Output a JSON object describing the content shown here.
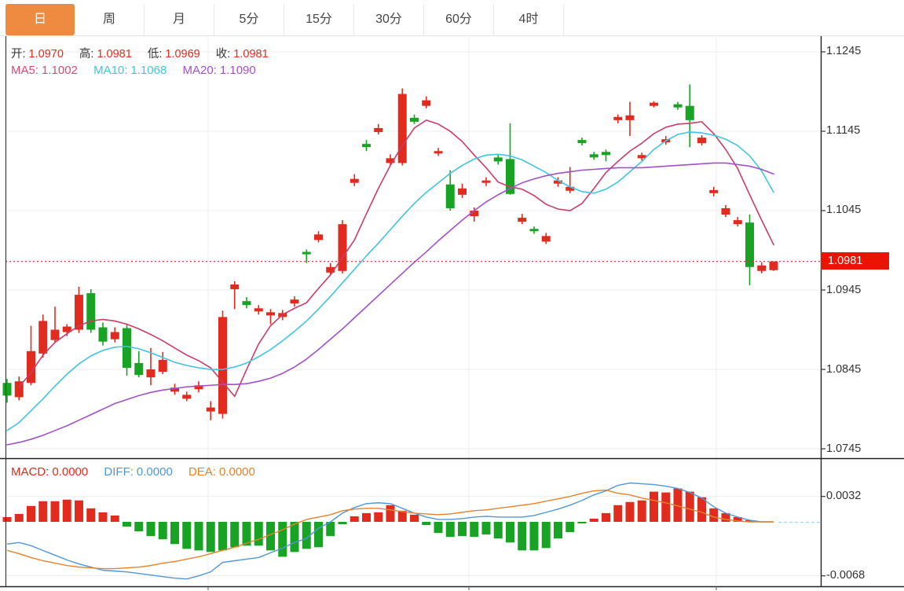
{
  "tabs": {
    "items": [
      {
        "label": "日",
        "active": true
      },
      {
        "label": "周",
        "active": false
      },
      {
        "label": "月",
        "active": false
      },
      {
        "label": "5分",
        "active": false
      },
      {
        "label": "15分",
        "active": false
      },
      {
        "label": "30分",
        "active": false
      },
      {
        "label": "60分",
        "active": false
      },
      {
        "label": "4时",
        "active": false
      }
    ]
  },
  "main_chart": {
    "info": {
      "open_label": "开:",
      "open_value": "1.0970",
      "high_label": "高:",
      "high_value": "1.0981",
      "low_label": "低:",
      "low_value": "1.0969",
      "close_label": "收:",
      "close_value": "1.0981"
    },
    "ma_info": {
      "ma5_label": "MA5:",
      "ma5_value": "1.1002",
      "ma10_label": "MA10:",
      "ma10_value": "1.1068",
      "ma20_label": "MA20:",
      "ma20_value": "1.1090"
    },
    "y_axis": [
      "1.1245",
      "1.1145",
      "1.1045",
      "1.0945",
      "1.0845",
      "1.0745"
    ],
    "price_tag": "1.0981"
  },
  "macd_panel": {
    "info": {
      "macd_label": "MACD:",
      "macd_value": "0.0000",
      "diff_label": "DIFF:",
      "diff_value": "0.0000",
      "dea_label": "DEA:",
      "dea_value": "0.0000"
    },
    "y_axis": [
      "0.0032",
      "-0.0068"
    ]
  },
  "colors": {
    "up": "#e12b1e",
    "down": "#18a325",
    "ma5": "#cc3c66",
    "ma10": "#41c4e0",
    "ma20": "#a052c8",
    "diff": "#4f97d9",
    "dea": "#e5822d",
    "tag": "#ea1403",
    "dotted": "#d32f2f",
    "grid": "#ededed",
    "frame": "#222222",
    "accent_tab": "#ef8b41"
  },
  "chart_data": [
    {
      "type": "candlestick",
      "title": "日K线 (daily candlesticks with MA5/MA10/MA20)",
      "ylim": [
        1.0745,
        1.1245
      ],
      "y_ticks": [
        1.1245,
        1.1145,
        1.1045,
        1.0945,
        1.0845,
        1.0745
      ],
      "grid": true,
      "last_price": 1.0981,
      "candles_ohlc": [
        [
          1.0828,
          1.0833,
          1.0803,
          1.0812
        ],
        [
          1.081,
          1.0836,
          1.0806,
          1.083
        ],
        [
          1.0828,
          1.09,
          1.0825,
          1.0868
        ],
        [
          1.0865,
          1.0914,
          1.086,
          1.0906
        ],
        [
          1.0882,
          1.0924,
          1.0879,
          1.0895
        ],
        [
          1.0892,
          1.0902,
          1.0887,
          1.0899
        ],
        [
          1.0895,
          1.0949,
          1.0891,
          1.0939
        ],
        [
          1.0941,
          1.0946,
          1.0891,
          1.0895
        ],
        [
          1.0898,
          1.0904,
          1.0875,
          1.088
        ],
        [
          1.0883,
          1.0898,
          1.0879,
          1.0892
        ],
        [
          1.0897,
          1.0901,
          1.0837,
          1.0847
        ],
        [
          1.0853,
          1.0868,
          1.0835,
          1.0838
        ],
        [
          1.0835,
          1.0872,
          1.0825,
          1.0845
        ],
        [
          1.0842,
          1.0867,
          1.0839,
          1.0857
        ],
        [
          1.0817,
          1.0827,
          1.0813,
          1.0822
        ],
        [
          1.0808,
          1.0817,
          1.0805,
          1.0813
        ],
        [
          1.082,
          1.083,
          1.0816,
          1.0825
        ],
        [
          1.0792,
          1.0805,
          1.0781,
          1.0797
        ],
        [
          1.0789,
          1.0919,
          1.0783,
          1.0911
        ],
        [
          1.0946,
          1.0956,
          1.0921,
          1.0952
        ],
        [
          1.0931,
          1.0936,
          1.0922,
          1.0926
        ],
        [
          1.0918,
          1.0926,
          1.0914,
          1.0922
        ],
        [
          1.0913,
          1.0921,
          1.0902,
          1.0917
        ],
        [
          1.0911,
          1.092,
          1.0907,
          1.0916
        ],
        [
          1.0928,
          1.0937,
          1.0924,
          1.0933
        ],
        [
          1.0993,
          1.0996,
          1.0979,
          1.099
        ],
        [
          1.1008,
          1.1019,
          1.1005,
          1.1015
        ],
        [
          1.0967,
          1.0979,
          1.0964,
          1.0974
        ],
        [
          1.0969,
          1.1033,
          1.0966,
          1.1028
        ],
        [
          1.108,
          1.1091,
          1.1076,
          1.1085
        ],
        [
          1.1129,
          1.1134,
          1.112,
          1.1125
        ],
        [
          1.1144,
          1.1154,
          1.1141,
          1.1149
        ],
        [
          1.1105,
          1.1116,
          1.1102,
          1.1111
        ],
        [
          1.1105,
          1.1199,
          1.1102,
          1.1192
        ],
        [
          1.1162,
          1.1166,
          1.1154,
          1.1157
        ],
        [
          1.1177,
          1.1189,
          1.1174,
          1.1184
        ],
        [
          1.1117,
          1.1124,
          1.1114,
          1.112
        ],
        [
          1.1078,
          1.1096,
          1.1045,
          1.1048
        ],
        [
          1.1065,
          1.1079,
          1.1061,
          1.1073
        ],
        [
          1.1038,
          1.1049,
          1.1031,
          1.1045
        ],
        [
          1.108,
          1.1087,
          1.1076,
          1.1083
        ],
        [
          1.1112,
          1.1116,
          1.1103,
          1.1107
        ],
        [
          1.111,
          1.1155,
          1.1065,
          1.1066
        ],
        [
          1.1031,
          1.1041,
          1.1028,
          1.1036
        ],
        [
          1.1022,
          1.1025,
          1.1016,
          1.1019
        ],
        [
          1.1006,
          1.1017,
          1.1003,
          1.1013
        ],
        [
          1.1079,
          1.1087,
          1.1075,
          1.1083
        ],
        [
          1.107,
          1.11,
          1.1067,
          1.1075
        ],
        [
          1.1134,
          1.1137,
          1.1127,
          1.113
        ],
        [
          1.1116,
          1.1119,
          1.1109,
          1.1112
        ],
        [
          1.1119,
          1.1122,
          1.1107,
          1.1115
        ],
        [
          1.1159,
          1.1166,
          1.1155,
          1.1163
        ],
        [
          1.1159,
          1.1182,
          1.1139,
          1.1165
        ],
        [
          1.1111,
          1.1118,
          1.1108,
          1.1115
        ],
        [
          1.1177,
          1.1183,
          1.1175,
          1.1181
        ],
        [
          1.1131,
          1.1139,
          1.1128,
          1.1135
        ],
        [
          1.1179,
          1.1182,
          1.1172,
          1.1175
        ],
        [
          1.1177,
          1.1204,
          1.1125,
          1.1159
        ],
        [
          1.113,
          1.114,
          1.1127,
          1.1137
        ],
        [
          1.1067,
          1.1075,
          1.1063,
          1.1071
        ],
        [
          1.104,
          1.1052,
          1.1037,
          1.1048
        ],
        [
          1.1028,
          1.1037,
          1.1025,
          1.1033
        ],
        [
          1.103,
          1.104,
          1.0951,
          1.0974
        ],
        [
          1.0969,
          1.098,
          1.0966,
          1.0976
        ],
        [
          1.097,
          1.0981,
          1.0969,
          1.0981
        ]
      ],
      "series": [
        {
          "name": "MA5",
          "values": [
            null,
            1.0823,
            1.0841,
            1.0863,
            1.0879,
            1.089,
            1.09,
            1.0906,
            1.0908,
            1.0906,
            1.0902,
            1.0896,
            1.0889,
            1.0881,
            1.0872,
            1.0863,
            1.0856,
            1.0847,
            1.0829,
            1.0811,
            1.0845,
            1.0877,
            1.09,
            1.0914,
            1.0922,
            1.0929,
            1.0947,
            1.0964,
            1.0986,
            1.1008,
            1.1041,
            1.1073,
            1.1102,
            1.1127,
            1.1149,
            1.1159,
            1.1154,
            1.1145,
            1.1132,
            1.1115,
            1.1099,
            1.1081,
            1.1075,
            1.1072,
            1.1064,
            1.1053,
            1.1047,
            1.1045,
            1.1054,
            1.1073,
            1.1093,
            1.1107,
            1.112,
            1.113,
            1.1142,
            1.115,
            1.1154,
            1.1155,
            1.1157,
            1.1142,
            1.1122,
            1.1098,
            1.1065,
            1.1033,
            1.1002
          ]
        },
        {
          "name": "MA10",
          "values": [
            1.0768,
            1.0778,
            1.0793,
            1.0808,
            1.0824,
            1.0839,
            1.0852,
            1.0862,
            1.0869,
            1.0873,
            1.0874,
            1.0871,
            1.0866,
            1.086,
            1.0854,
            1.085,
            1.0847,
            1.0845,
            1.0845,
            1.0848,
            1.0853,
            1.0861,
            1.087,
            1.0881,
            1.0893,
            1.0906,
            1.0921,
            1.0937,
            1.0954,
            1.0971,
            1.0988,
            1.1004,
            1.1021,
            1.1038,
            1.1054,
            1.1068,
            1.108,
            1.1092,
            1.1102,
            1.111,
            1.1115,
            1.1116,
            1.1114,
            1.1109,
            1.1101,
            1.1093,
            1.1083,
            1.1075,
            1.1069,
            1.1067,
            1.1072,
            1.1081,
            1.1094,
            1.1107,
            1.1122,
            1.1133,
            1.1141,
            1.1144,
            1.1143,
            1.114,
            1.1135,
            1.1127,
            1.1114,
            1.1095,
            1.1068
          ]
        },
        {
          "name": "MA20",
          "values": [
            1.075,
            1.0753,
            1.0757,
            1.0762,
            1.0768,
            1.0774,
            1.0781,
            1.0788,
            1.0795,
            1.0802,
            1.0807,
            1.0812,
            1.0816,
            1.0819,
            1.0821,
            1.0823,
            1.0824,
            1.0825,
            1.0826,
            1.0826,
            1.0827,
            1.083,
            1.0834,
            1.084,
            1.0848,
            1.0858,
            1.087,
            1.0883,
            1.0896,
            1.091,
            1.0924,
            1.0938,
            1.0952,
            1.0966,
            1.098,
            1.0993,
            1.1007,
            1.102,
            1.1033,
            1.1045,
            1.1056,
            1.1065,
            1.1073,
            1.108,
            1.1085,
            1.1089,
            1.1092,
            1.1094,
            1.1096,
            1.1097,
            1.1098,
            1.1099,
            1.1099,
            1.1099,
            1.11,
            1.1101,
            1.1102,
            1.1103,
            1.1104,
            1.1105,
            1.1105,
            1.1103,
            1.1101,
            1.1097,
            1.1091
          ]
        }
      ]
    },
    {
      "type": "bar",
      "title": "MACD",
      "ylim": [
        -0.0068,
        0.0032
      ],
      "y_ticks": [
        0.0032,
        -0.0068
      ],
      "grid": true,
      "histogram": [
        0.0006,
        0.001,
        0.002,
        0.0026,
        0.0026,
        0.0028,
        0.0027,
        0.0017,
        0.0012,
        0.0008,
        -0.0006,
        -0.0012,
        -0.0018,
        -0.0022,
        -0.0028,
        -0.0034,
        -0.0036,
        -0.0038,
        -0.0036,
        -0.0032,
        -0.003,
        -0.003,
        -0.0036,
        -0.0044,
        -0.0038,
        -0.0034,
        -0.0032,
        -0.0018,
        -0.0003,
        0.0007,
        0.0011,
        0.0012,
        0.0021,
        0.0014,
        0.0009,
        -0.0004,
        -0.0014,
        -0.0019,
        -0.0018,
        -0.0019,
        -0.0016,
        -0.0021,
        -0.0026,
        -0.0036,
        -0.0036,
        -0.0033,
        -0.0021,
        -0.0013,
        -0.0002,
        0.0004,
        0.0011,
        0.0021,
        0.0025,
        0.0027,
        0.0038,
        0.0037,
        0.0042,
        0.0038,
        0.0031,
        0.0017,
        0.0011,
        0.0006,
        0.0002,
        0,
        0
      ],
      "series": [
        {
          "name": "DIFF",
          "values": [
            -0.0028,
            -0.0026,
            -0.003,
            -0.0036,
            -0.0042,
            -0.0048,
            -0.0053,
            -0.0057,
            -0.0061,
            -0.0062,
            -0.0063,
            -0.0065,
            -0.0067,
            -0.0069,
            -0.0071,
            -0.0072,
            -0.0068,
            -0.0063,
            -0.0051,
            -0.0049,
            -0.0047,
            -0.0045,
            -0.0039,
            -0.0033,
            -0.0026,
            -0.0021,
            -0.0008,
            0.0,
            0.0011,
            0.0018,
            0.0023,
            0.0024,
            0.0023,
            0.0017,
            0.0011,
            0.0006,
            0.0003,
            0.0003,
            0.0004,
            0.0006,
            0.0007,
            0.0006,
            0.0006,
            0.0006,
            0.0008,
            0.0012,
            0.0016,
            0.0021,
            0.0027,
            0.0034,
            0.0039,
            0.0046,
            0.0049,
            0.0048,
            0.0047,
            0.0045,
            0.0042,
            0.0037,
            0.003,
            0.0019,
            0.0011,
            0.0006,
            0.0002,
            0,
            0
          ]
        },
        {
          "name": "DEA",
          "values": [
            -0.0036,
            -0.004,
            -0.0045,
            -0.0049,
            -0.0052,
            -0.0055,
            -0.0057,
            -0.0058,
            -0.0059,
            -0.0059,
            -0.0058,
            -0.0057,
            -0.0055,
            -0.0052,
            -0.005,
            -0.0047,
            -0.0044,
            -0.004,
            -0.0036,
            -0.0032,
            -0.0027,
            -0.0022,
            -0.0016,
            -0.001,
            -0.0003,
            0.0003,
            0.0006,
            0.0009,
            0.0014,
            0.0016,
            0.0017,
            0.0017,
            0.0015,
            0.0013,
            0.0011,
            0.001,
            0.0009,
            0.001,
            0.0012,
            0.0014,
            0.0015,
            0.0017,
            0.0019,
            0.0021,
            0.0023,
            0.0026,
            0.0029,
            0.0032,
            0.0036,
            0.0039,
            0.004,
            0.0036,
            0.0034,
            0.003,
            0.0027,
            0.0024,
            0.002,
            0.0016,
            0.0012,
            0.0006,
            0.0003,
            0.0001,
            0.0,
            0,
            0
          ]
        }
      ]
    }
  ]
}
